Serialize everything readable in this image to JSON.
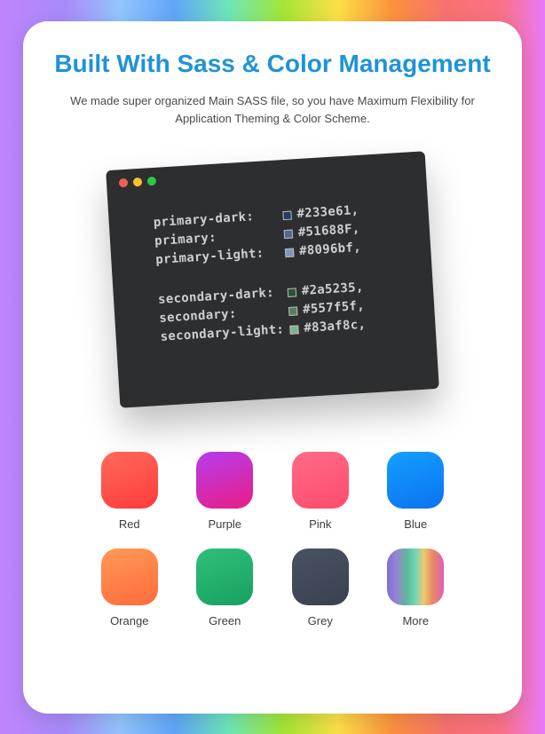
{
  "title": "Built With Sass & Color Management",
  "subtitle": "We made super organized Main SASS file, so you have Maximum Flexibility for Application Theming & Color Scheme.",
  "code": [
    {
      "key": "primary-dark:",
      "swatch": "#233e61",
      "hex": "#233e61,"
    },
    {
      "key": "primary:",
      "swatch": "#51688F",
      "hex": "#51688F,"
    },
    {
      "key": "primary-light:",
      "swatch": "#8096bf",
      "hex": "#8096bf,"
    },
    {
      "gap": true
    },
    {
      "key": "secondary-dark:",
      "swatch": "#2a5235",
      "hex": "#2a5235,"
    },
    {
      "key": "secondary:",
      "swatch": "#557f5f",
      "hex": "#557f5f,"
    },
    {
      "key": "secondary-light:",
      "swatch": "#83af8c",
      "hex": "#83af8c,"
    }
  ],
  "palette": [
    {
      "label": "Red",
      "class": "t-red"
    },
    {
      "label": "Purple",
      "class": "t-purple"
    },
    {
      "label": "Pink",
      "class": "t-pink"
    },
    {
      "label": "Blue",
      "class": "t-blue"
    },
    {
      "label": "Orange",
      "class": "t-orange"
    },
    {
      "label": "Green",
      "class": "t-green"
    },
    {
      "label": "Grey",
      "class": "t-grey"
    },
    {
      "label": "More",
      "class": "t-more"
    }
  ]
}
